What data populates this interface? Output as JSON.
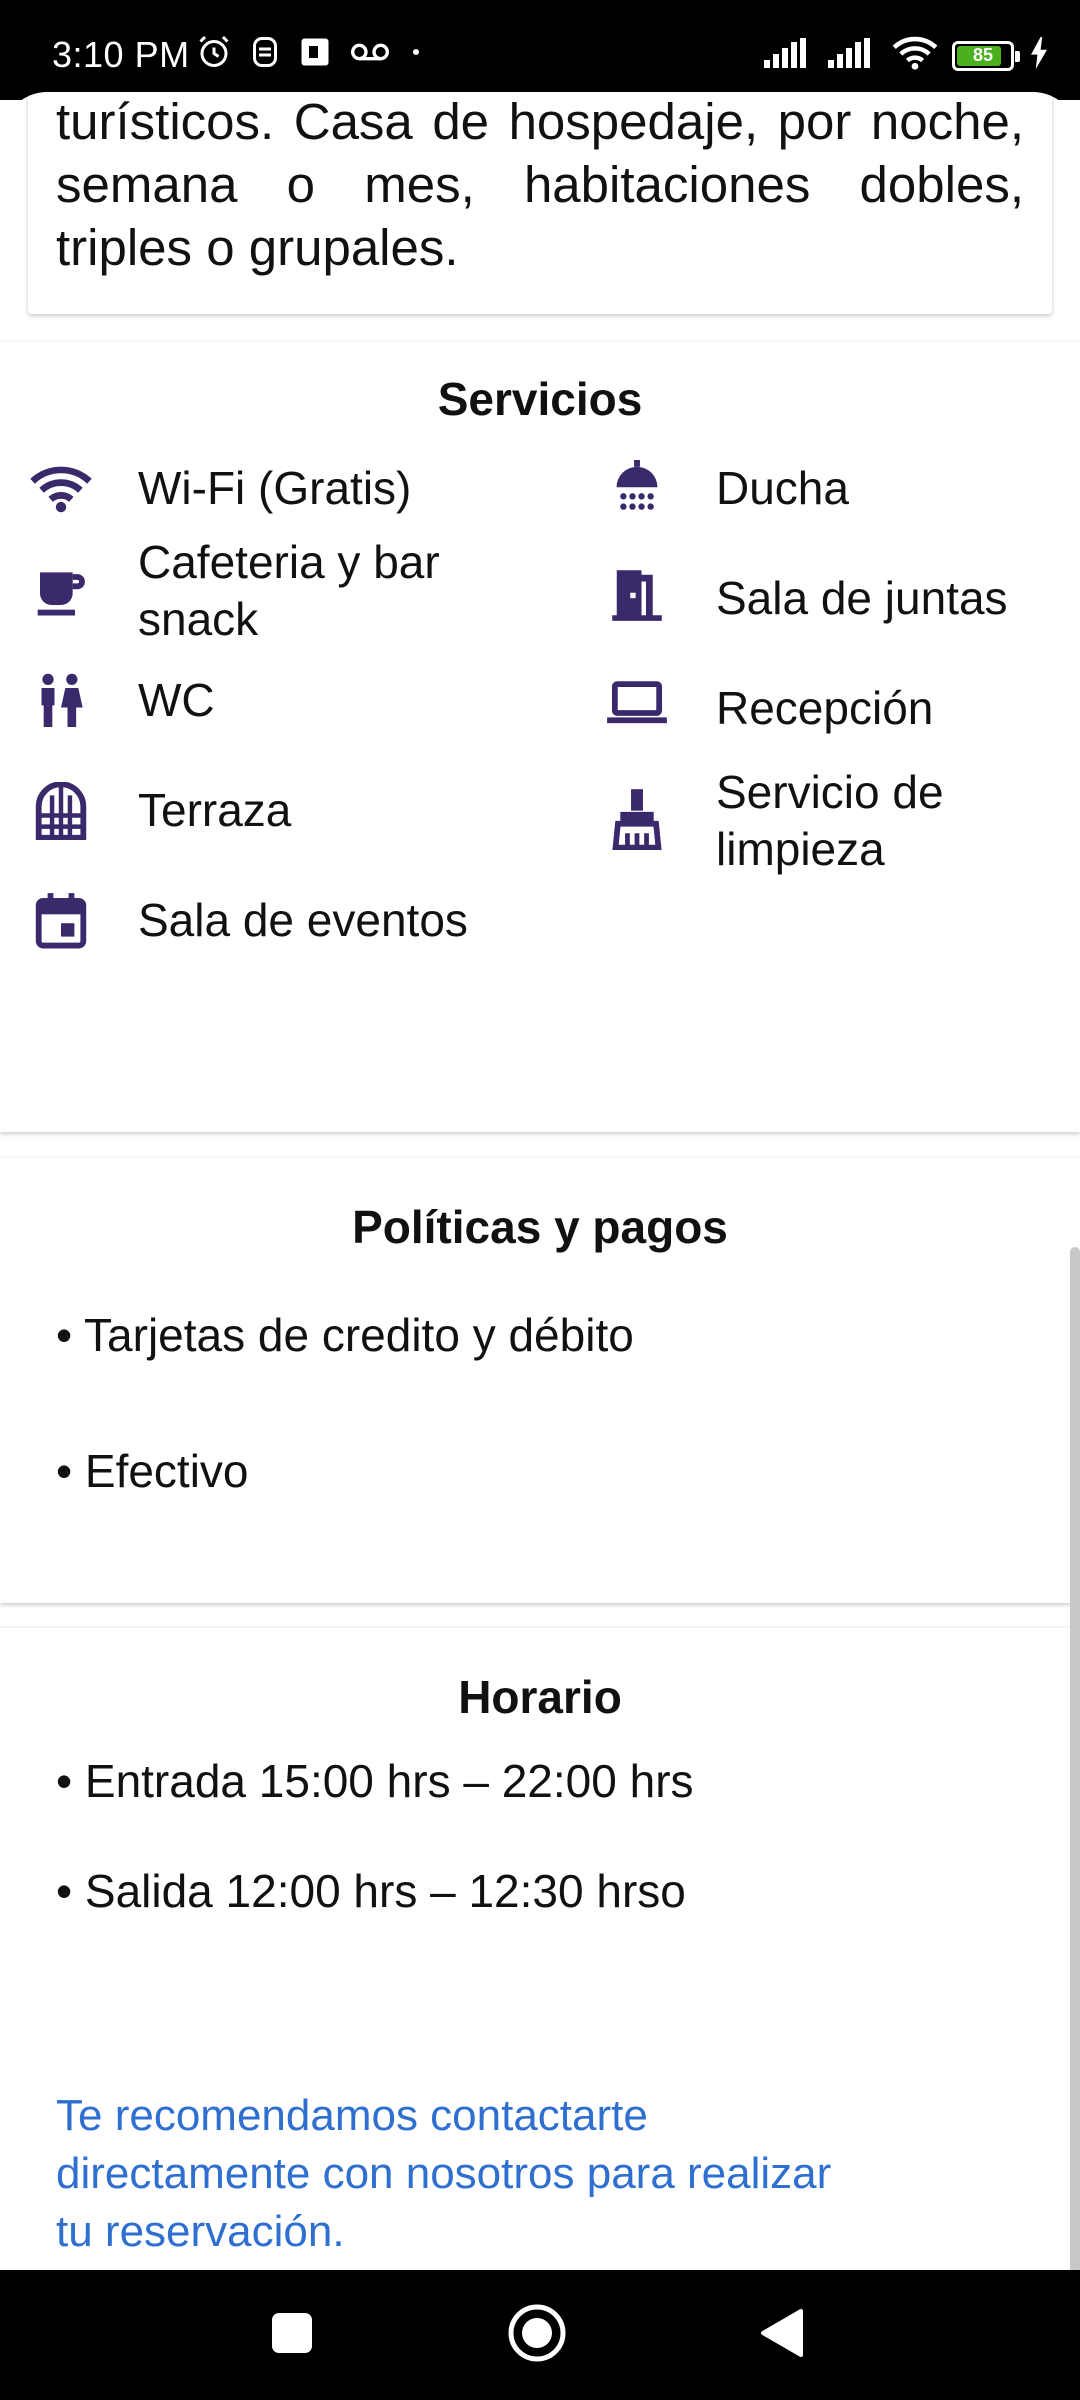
{
  "status_bar": {
    "time": "3:10 PM",
    "battery_level": 85,
    "battery_text": "85",
    "icons_left": [
      "alarm-icon",
      "notification-icon",
      "sim-icon",
      "voicemail-icon",
      "dot-icon"
    ],
    "icons_right": [
      "signal-icon",
      "signal-icon-2",
      "wifi-icon",
      "battery-icon",
      "charging-icon"
    ]
  },
  "description": {
    "text": "turísticos. Casa de hospedaje, por noche, semana o mes, habitaciones dobles, triples o grupales."
  },
  "services": {
    "title": "Servicios",
    "left": [
      {
        "icon": "wifi-icon",
        "label": "Wi-Fi (Gratis)"
      },
      {
        "icon": "coffee-icon",
        "label": "Cafeteria y bar snack"
      },
      {
        "icon": "restroom-icon",
        "label": "WC"
      },
      {
        "icon": "terrace-icon",
        "label": "Terraza"
      },
      {
        "icon": "calendar-icon",
        "label": "Sala de eventos"
      }
    ],
    "right": [
      {
        "icon": "shower-icon",
        "label": "Ducha"
      },
      {
        "icon": "meeting-room-icon",
        "label": "Sala de juntas"
      },
      {
        "icon": "laptop-icon",
        "label": "Recepción"
      },
      {
        "icon": "cleaning-icon",
        "label": "Servicio de limpieza"
      }
    ]
  },
  "policies": {
    "title": "Políticas y pagos",
    "items": [
      "• Tarjetas de credito y débito",
      "• Efectivo"
    ]
  },
  "schedule": {
    "title": "Horario",
    "items": [
      "• Entrada 15:00 hrs – 22:00 hrs",
      "• Salida 12:00 hrs – 12:30 hrso"
    ]
  },
  "contact": {
    "text": "Te recomendamos contactarte directamente con nosotros para realizar tu reservación."
  },
  "nav": {
    "buttons": [
      "recents-button",
      "home-button",
      "back-button"
    ]
  },
  "colors": {
    "icon": "#3b2a6b",
    "link": "#2e6fd0",
    "battery": "#4caf1e"
  }
}
